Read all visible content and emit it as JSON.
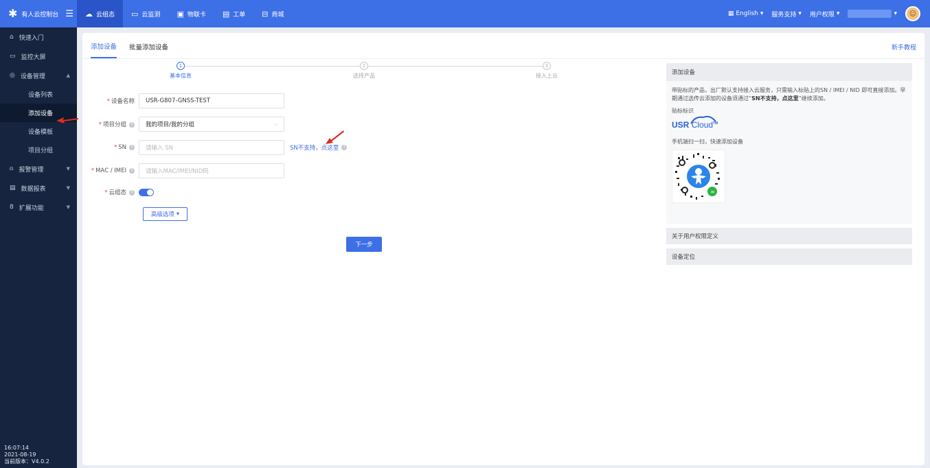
{
  "topbar": {
    "brand_title": "有人云控制台",
    "nav": [
      {
        "label": "云组态",
        "icon": "cloud-icon",
        "active": true
      },
      {
        "label": "云监测",
        "icon": "monitor-icon",
        "active": false
      },
      {
        "label": "物联卡",
        "icon": "sim-card-icon",
        "active": false
      },
      {
        "label": "工单",
        "icon": "ticket-icon",
        "active": false
      },
      {
        "label": "商城",
        "icon": "shop-icon",
        "active": false
      }
    ],
    "language": "English",
    "service_support": "服务支持",
    "user_permissions": "用户权限"
  },
  "sidebar": {
    "items": [
      {
        "label": "快速入门",
        "icon": "home-icon"
      },
      {
        "label": "监控大屏",
        "icon": "screen-icon"
      },
      {
        "label": "设备管理",
        "icon": "device-icon"
      }
    ],
    "sub_items": [
      "设备列表",
      "添加设备",
      "设备模板",
      "项目分组"
    ],
    "more_items": [
      {
        "label": "报警管理",
        "icon": "bell-icon"
      },
      {
        "label": "数据报表",
        "icon": "report-icon"
      },
      {
        "label": "扩展功能",
        "icon": "extension-icon"
      }
    ],
    "footer": {
      "time": "16:07:14",
      "date": "2021-08-19",
      "version": "当前版本：V4.0.2"
    }
  },
  "tabs": {
    "add_device": "添加设备",
    "batch_add": "批量添加设备",
    "tutorial": "新手教程"
  },
  "steps": [
    {
      "num": "1",
      "label": "基本信息"
    },
    {
      "num": "2",
      "label": "选择产品"
    },
    {
      "num": "3",
      "label": "接入上云"
    }
  ],
  "form": {
    "device_name_label": "设备名称",
    "device_name_value": "USR-G807-GNSS-TEST",
    "project_group_label": "项目分组",
    "project_group_value": "我的项目/我的分组",
    "sn_label": "SN",
    "sn_placeholder": "请输入 SN",
    "sn_link": "SN不支持，点这里",
    "mac_label": "MAC / IMEI",
    "mac_placeholder": "请输入MAC/IMEI/NID码",
    "cloud_label": "云组态",
    "advanced_label": "高级选项",
    "next_label": "下一步"
  },
  "info": {
    "title": "添加设备",
    "text1": "带贴标的产品，出厂默认支持接入云服务，只需输入标贴上的SN / IMEI / NID 即可直接添加。早期通过选传云添加的设备须通过“",
    "text_bold": "SN不支持，点这里",
    "text2": "”继续添加。",
    "tag_label": "贴标标识",
    "logo_usr": "USR",
    "logo_cloud": "Cloud",
    "logo_tm": "TM",
    "scan_text": "手机端扫一扫，快速添加设备",
    "section1": "关于用户权限定义",
    "section2": "设备定位"
  },
  "colors": {
    "primary": "#3d6fe6",
    "sidebar_bg": "#16243f",
    "required": "#e6423a",
    "annotation_arrow": "#e02b20"
  }
}
